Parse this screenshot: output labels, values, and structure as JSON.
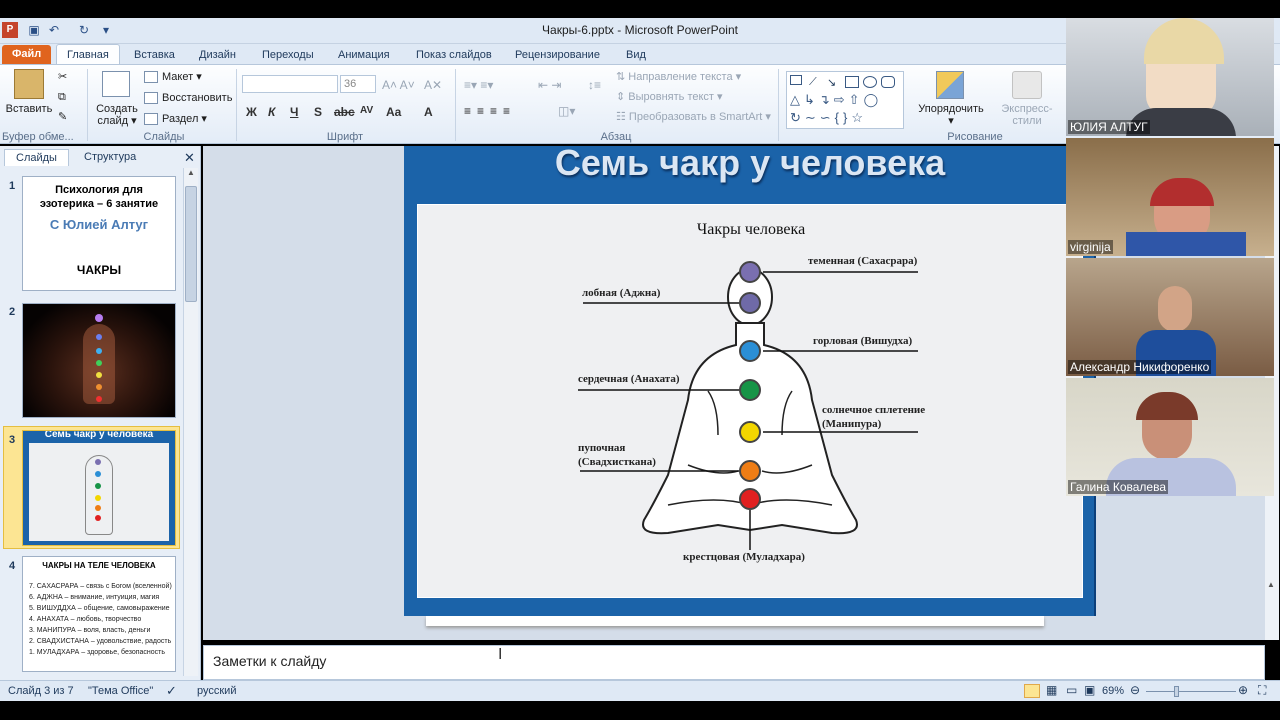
{
  "window": {
    "title": "Чакры-6.pptx  -  Microsoft PowerPoint"
  },
  "tabs": [
    "Файл",
    "Главная",
    "Вставка",
    "Дизайн",
    "Переходы",
    "Анимация",
    "Показ слайдов",
    "Рецензирование",
    "Вид"
  ],
  "ribbon": {
    "paste": "Вставить",
    "clipboard_group": "Буфер обме...",
    "new_slide_1": "Создать",
    "new_slide_2": "слайд",
    "layout": "Макет",
    "reset": "Восстановить",
    "section": "Раздел",
    "slides_group": "Слайды",
    "font_size": "36",
    "font_group": "Шрифт",
    "text_direction": "Направление текста",
    "align_text": "Выровнять текст",
    "smartart": "Преобразовать в SmartArt",
    "paragraph_group": "Абзац",
    "arrange": "Упорядочить",
    "quick_styles": "Экспресс-стили",
    "drawing_group": "Рисование"
  },
  "panel": {
    "tab_slides": "Слайды",
    "tab_outline": "Структура"
  },
  "thumbnails": [
    {
      "num": "1",
      "line1": "Психология для",
      "line2": "эзотерика – 6 занятие",
      "line3": "С Юлией Алтуг",
      "line4": "ЧАКРЫ"
    },
    {
      "num": "2"
    },
    {
      "num": "3",
      "title": "Семь чакр у человека"
    },
    {
      "num": "4",
      "title": "ЧАКРЫ НА ТЕЛЕ ЧЕЛОВЕКА",
      "items": [
        "7. САХАСРАРА – связь с Богом (вселенной)",
        "6. АДЖНА – внимание, интуиция, магия",
        "5. ВИШУДДХА – общение, самовыражение",
        "4. АНАХАТА – любовь, творчество",
        "3. МАНИПУРА – воля, власть, деньги",
        "2. СВАДХИСТАНА – удовольствие, радость",
        "1. МУЛАДХАРА – здоровье, безопасность"
      ]
    }
  ],
  "slide": {
    "title": "Семь чакр у человека",
    "diagram_title": "Чакры человека",
    "labels": {
      "crown": "теменная (Сахасрара)",
      "brow": "лобная (Аджна)",
      "throat": "горловая (Вишудха)",
      "heart": "сердечная (Анахата)",
      "solar_1": "солнечное сплетение",
      "solar_2": "(Манипура)",
      "sacral_1": "пупочная",
      "sacral_2": "(Свадхисткана)",
      "root": "крестцовая (Муладхара)"
    },
    "chakra_colors": [
      "#7a6fb0",
      "#6f6aa8",
      "#2b8fd6",
      "#179447",
      "#f3d600",
      "#ee7d15",
      "#e02020"
    ]
  },
  "notes": {
    "placeholder": "Заметки к слайду"
  },
  "status": {
    "slide_info": "Слайд 3 из 7",
    "theme": "\"Тема Office\"",
    "language": "русский",
    "zoom": "69%"
  },
  "participants": [
    "ЮЛИЯ АЛТУГ",
    "virginija",
    "Александр Никифоренко",
    "Галина Ковалева"
  ]
}
